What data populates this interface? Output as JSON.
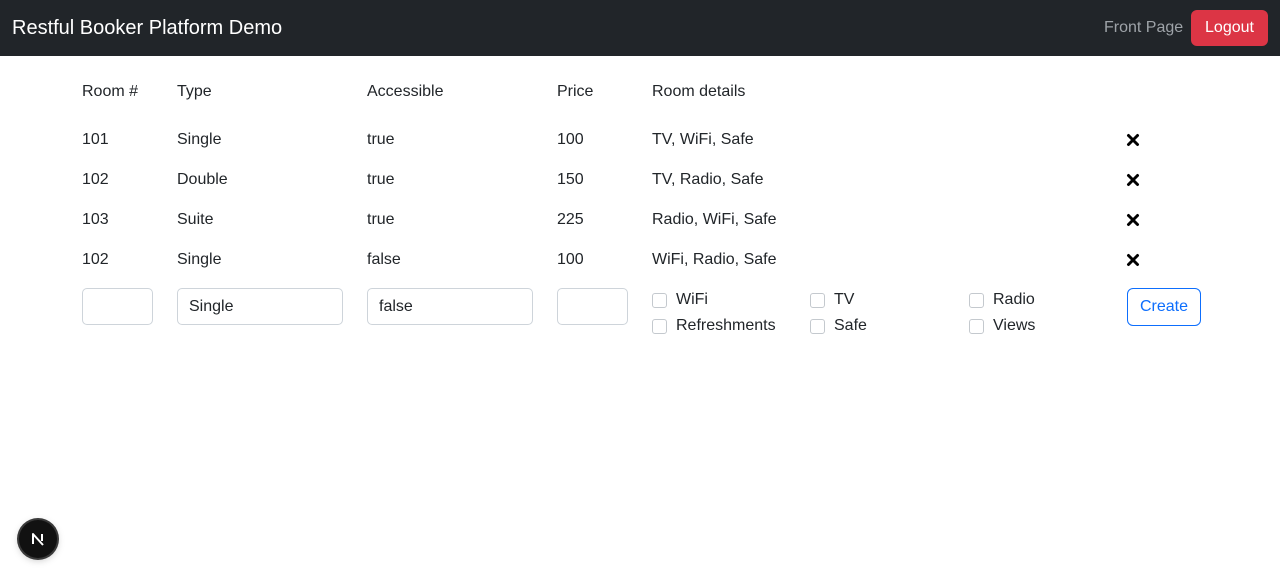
{
  "navbar": {
    "brand": "Restful Booker Platform Demo",
    "front_page": "Front Page",
    "logout": "Logout"
  },
  "table": {
    "headers": {
      "room_number": "Room #",
      "type": "Type",
      "accessible": "Accessible",
      "price": "Price",
      "details": "Room details"
    },
    "rows": [
      {
        "number": "101",
        "type": "Single",
        "accessible": "true",
        "price": "100",
        "details": "TV, WiFi, Safe",
        "delete_icon": "close-icon"
      },
      {
        "number": "102",
        "type": "Double",
        "accessible": "true",
        "price": "150",
        "details": "TV, Radio, Safe",
        "delete_icon": "close-icon"
      },
      {
        "number": "103",
        "type": "Suite",
        "accessible": "true",
        "price": "225",
        "details": "Radio, WiFi, Safe",
        "delete_icon": "close-icon"
      },
      {
        "number": "102",
        "type": "Single",
        "accessible": "false",
        "price": "100",
        "details": "WiFi, Radio, Safe",
        "delete_icon": "close-icon"
      }
    ]
  },
  "form": {
    "room_number_value": "",
    "type_selected": "Single",
    "accessible_selected": "false",
    "price_value": "",
    "features": [
      {
        "label": "WiFi",
        "checked": false
      },
      {
        "label": "TV",
        "checked": false
      },
      {
        "label": "Radio",
        "checked": false
      },
      {
        "label": "Refreshments",
        "checked": false
      },
      {
        "label": "Safe",
        "checked": false
      },
      {
        "label": "Views",
        "checked": false
      }
    ],
    "create": "Create"
  },
  "badge": {
    "letter_icon": "n-logo-icon"
  },
  "colors": {
    "navbar_bg": "#212529",
    "logout_bg": "#dc3545",
    "primary": "#0d6efd"
  }
}
